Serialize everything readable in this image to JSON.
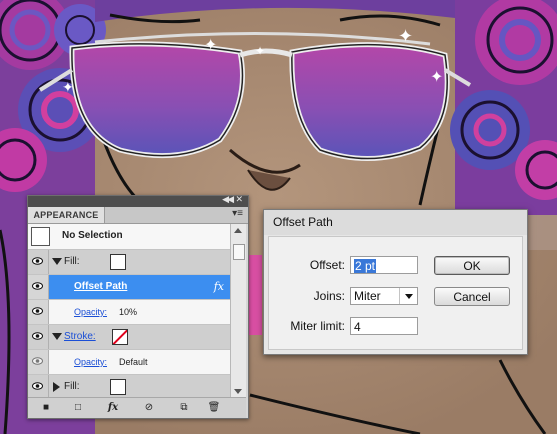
{
  "colors": {
    "skin": "#a98b73",
    "hair_purple": "#a33ea2",
    "hair_blue": "#5a4fb7",
    "lens_top": "#b447a8",
    "lens_bottom": "#5a54b8",
    "selection_blue": "#3c8ef0",
    "stroke_none": "#e0001b"
  },
  "appearance_panel": {
    "tab_label": "APPEARANCE",
    "menu_icon": "panel-menu-icon",
    "selection_label": "No Selection",
    "fill_label": "Fill:",
    "offset_path_label": "Offset Path",
    "fx_label": "fx",
    "opacity_label": "Opacity:",
    "opacity_value_1": "10%",
    "stroke_label": "Stroke:",
    "opacity_value_2": "Default",
    "fill_label_2": "Fill:",
    "footer": {
      "new_art_icon": "new-art-icon",
      "clear_icon": "clear-appearance-icon",
      "fx_menu_label": "fx",
      "reduce_icon": "reduce-appearance-icon",
      "duplicate_icon": "duplicate-item-icon",
      "delete_icon": "trash-icon"
    }
  },
  "offset_dialog": {
    "title": "Offset Path",
    "offset_label": "Offset:",
    "offset_value": "2 pt",
    "joins_label": "Joins:",
    "joins_value": "Miter",
    "miter_label": "Miter limit:",
    "miter_value": "4",
    "ok_label": "OK",
    "cancel_label": "Cancel"
  }
}
